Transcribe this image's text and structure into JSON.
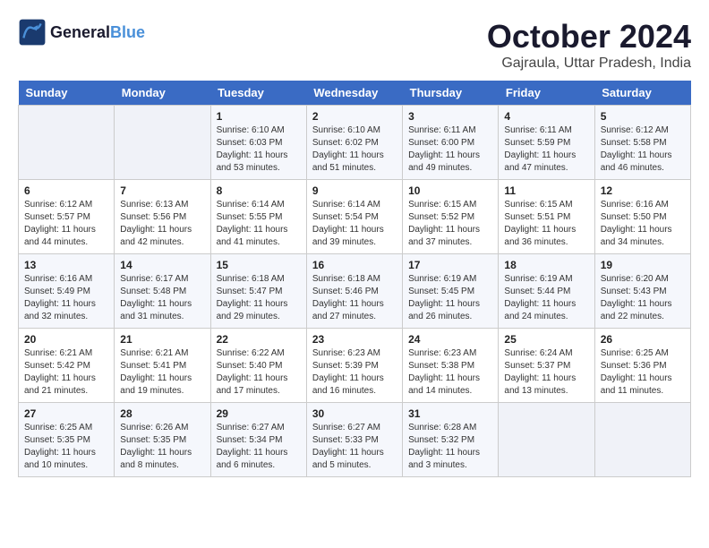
{
  "header": {
    "logo_line1": "General",
    "logo_line2": "Blue",
    "month_title": "October 2024",
    "location": "Gajraula, Uttar Pradesh, India"
  },
  "days_of_week": [
    "Sunday",
    "Monday",
    "Tuesday",
    "Wednesday",
    "Thursday",
    "Friday",
    "Saturday"
  ],
  "weeks": [
    [
      {
        "day": "",
        "info": ""
      },
      {
        "day": "",
        "info": ""
      },
      {
        "day": "1",
        "info": "Sunrise: 6:10 AM\nSunset: 6:03 PM\nDaylight: 11 hours and 53 minutes."
      },
      {
        "day": "2",
        "info": "Sunrise: 6:10 AM\nSunset: 6:02 PM\nDaylight: 11 hours and 51 minutes."
      },
      {
        "day": "3",
        "info": "Sunrise: 6:11 AM\nSunset: 6:00 PM\nDaylight: 11 hours and 49 minutes."
      },
      {
        "day": "4",
        "info": "Sunrise: 6:11 AM\nSunset: 5:59 PM\nDaylight: 11 hours and 47 minutes."
      },
      {
        "day": "5",
        "info": "Sunrise: 6:12 AM\nSunset: 5:58 PM\nDaylight: 11 hours and 46 minutes."
      }
    ],
    [
      {
        "day": "6",
        "info": "Sunrise: 6:12 AM\nSunset: 5:57 PM\nDaylight: 11 hours and 44 minutes."
      },
      {
        "day": "7",
        "info": "Sunrise: 6:13 AM\nSunset: 5:56 PM\nDaylight: 11 hours and 42 minutes."
      },
      {
        "day": "8",
        "info": "Sunrise: 6:14 AM\nSunset: 5:55 PM\nDaylight: 11 hours and 41 minutes."
      },
      {
        "day": "9",
        "info": "Sunrise: 6:14 AM\nSunset: 5:54 PM\nDaylight: 11 hours and 39 minutes."
      },
      {
        "day": "10",
        "info": "Sunrise: 6:15 AM\nSunset: 5:52 PM\nDaylight: 11 hours and 37 minutes."
      },
      {
        "day": "11",
        "info": "Sunrise: 6:15 AM\nSunset: 5:51 PM\nDaylight: 11 hours and 36 minutes."
      },
      {
        "day": "12",
        "info": "Sunrise: 6:16 AM\nSunset: 5:50 PM\nDaylight: 11 hours and 34 minutes."
      }
    ],
    [
      {
        "day": "13",
        "info": "Sunrise: 6:16 AM\nSunset: 5:49 PM\nDaylight: 11 hours and 32 minutes."
      },
      {
        "day": "14",
        "info": "Sunrise: 6:17 AM\nSunset: 5:48 PM\nDaylight: 11 hours and 31 minutes."
      },
      {
        "day": "15",
        "info": "Sunrise: 6:18 AM\nSunset: 5:47 PM\nDaylight: 11 hours and 29 minutes."
      },
      {
        "day": "16",
        "info": "Sunrise: 6:18 AM\nSunset: 5:46 PM\nDaylight: 11 hours and 27 minutes."
      },
      {
        "day": "17",
        "info": "Sunrise: 6:19 AM\nSunset: 5:45 PM\nDaylight: 11 hours and 26 minutes."
      },
      {
        "day": "18",
        "info": "Sunrise: 6:19 AM\nSunset: 5:44 PM\nDaylight: 11 hours and 24 minutes."
      },
      {
        "day": "19",
        "info": "Sunrise: 6:20 AM\nSunset: 5:43 PM\nDaylight: 11 hours and 22 minutes."
      }
    ],
    [
      {
        "day": "20",
        "info": "Sunrise: 6:21 AM\nSunset: 5:42 PM\nDaylight: 11 hours and 21 minutes."
      },
      {
        "day": "21",
        "info": "Sunrise: 6:21 AM\nSunset: 5:41 PM\nDaylight: 11 hours and 19 minutes."
      },
      {
        "day": "22",
        "info": "Sunrise: 6:22 AM\nSunset: 5:40 PM\nDaylight: 11 hours and 17 minutes."
      },
      {
        "day": "23",
        "info": "Sunrise: 6:23 AM\nSunset: 5:39 PM\nDaylight: 11 hours and 16 minutes."
      },
      {
        "day": "24",
        "info": "Sunrise: 6:23 AM\nSunset: 5:38 PM\nDaylight: 11 hours and 14 minutes."
      },
      {
        "day": "25",
        "info": "Sunrise: 6:24 AM\nSunset: 5:37 PM\nDaylight: 11 hours and 13 minutes."
      },
      {
        "day": "26",
        "info": "Sunrise: 6:25 AM\nSunset: 5:36 PM\nDaylight: 11 hours and 11 minutes."
      }
    ],
    [
      {
        "day": "27",
        "info": "Sunrise: 6:25 AM\nSunset: 5:35 PM\nDaylight: 11 hours and 10 minutes."
      },
      {
        "day": "28",
        "info": "Sunrise: 6:26 AM\nSunset: 5:35 PM\nDaylight: 11 hours and 8 minutes."
      },
      {
        "day": "29",
        "info": "Sunrise: 6:27 AM\nSunset: 5:34 PM\nDaylight: 11 hours and 6 minutes."
      },
      {
        "day": "30",
        "info": "Sunrise: 6:27 AM\nSunset: 5:33 PM\nDaylight: 11 hours and 5 minutes."
      },
      {
        "day": "31",
        "info": "Sunrise: 6:28 AM\nSunset: 5:32 PM\nDaylight: 11 hours and 3 minutes."
      },
      {
        "day": "",
        "info": ""
      },
      {
        "day": "",
        "info": ""
      }
    ]
  ]
}
